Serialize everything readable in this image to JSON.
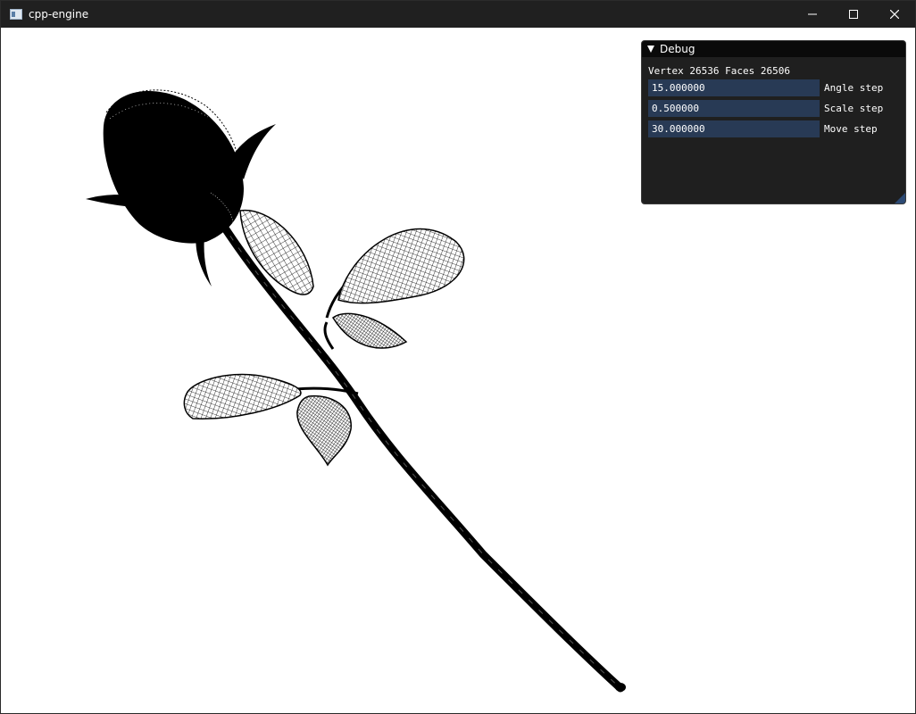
{
  "window": {
    "title": "cpp-engine",
    "icon": "app-window-icon",
    "controls": [
      "minimize-icon",
      "maximize-icon",
      "close-icon"
    ]
  },
  "scene": {
    "subject": "rose-wireframe-model",
    "render_mode": "wireframe",
    "stroke_color": "#000000",
    "background_color": "#ffffff"
  },
  "debug_panel": {
    "title": "Debug",
    "collapse_icon": "triangle-down-icon",
    "stats": "Vertex 26536 Faces 26506",
    "fields": [
      {
        "value": "15.000000",
        "label": "Angle step"
      },
      {
        "value": "0.500000",
        "label": "Scale step"
      },
      {
        "value": "30.000000",
        "label": "Move step"
      }
    ],
    "colors": {
      "panel_bg": "#161616",
      "header_bg": "#0a0a0a",
      "input_bg": "#283a55",
      "grip": "#2d4a74"
    }
  }
}
